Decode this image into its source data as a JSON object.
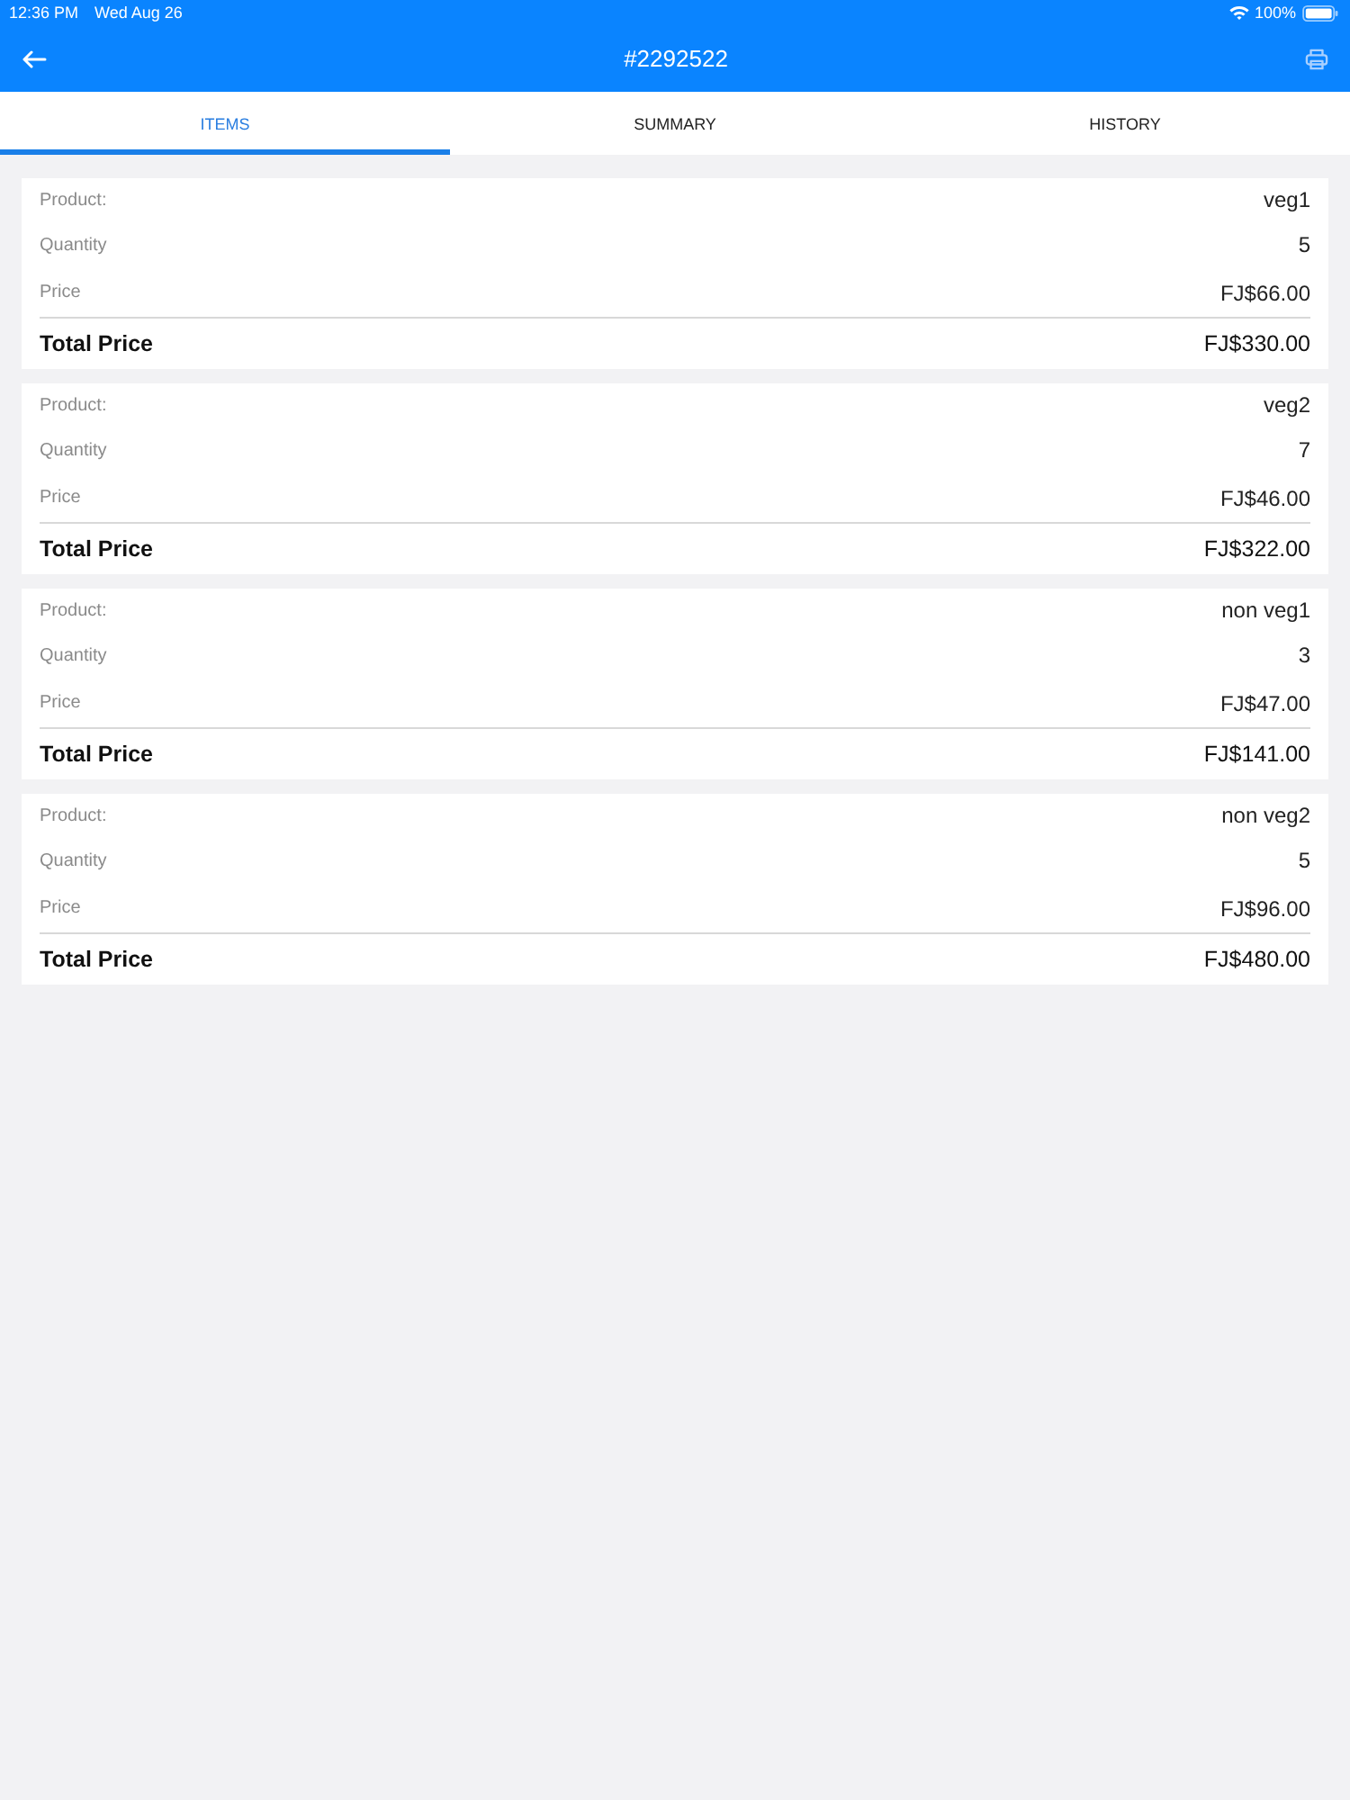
{
  "status_bar": {
    "time": "12:36 PM",
    "date": "Wed Aug 26",
    "battery_text": "100%"
  },
  "header": {
    "title": "#2292522"
  },
  "tabs": [
    {
      "label": "ITEMS",
      "selected": true
    },
    {
      "label": "SUMMARY",
      "selected": false
    },
    {
      "label": "HISTORY",
      "selected": false
    }
  ],
  "items": [
    {
      "rows": [
        {
          "label": "Product:",
          "value": "veg1"
        },
        {
          "label": "Quantity",
          "value": "5"
        },
        {
          "label": "Price",
          "value": "FJ$66.00"
        }
      ],
      "total": {
        "label": "Total Price",
        "value": "FJ$330.00"
      }
    },
    {
      "rows": [
        {
          "label": "Product:",
          "value": "veg2"
        },
        {
          "label": "Quantity",
          "value": "7"
        },
        {
          "label": "Price",
          "value": "FJ$46.00"
        }
      ],
      "total": {
        "label": "Total Price",
        "value": "FJ$322.00"
      }
    },
    {
      "rows": [
        {
          "label": "Product:",
          "value": "non veg1"
        },
        {
          "label": "Quantity",
          "value": "3"
        },
        {
          "label": "Price",
          "value": "FJ$47.00"
        }
      ],
      "total": {
        "label": "Total Price",
        "value": "FJ$141.00"
      }
    },
    {
      "rows": [
        {
          "label": "Product:",
          "value": "non veg2"
        },
        {
          "label": "Quantity",
          "value": "5"
        },
        {
          "label": "Price",
          "value": "FJ$96.00"
        }
      ],
      "total": {
        "label": "Total Price",
        "value": "FJ$480.00"
      }
    }
  ]
}
